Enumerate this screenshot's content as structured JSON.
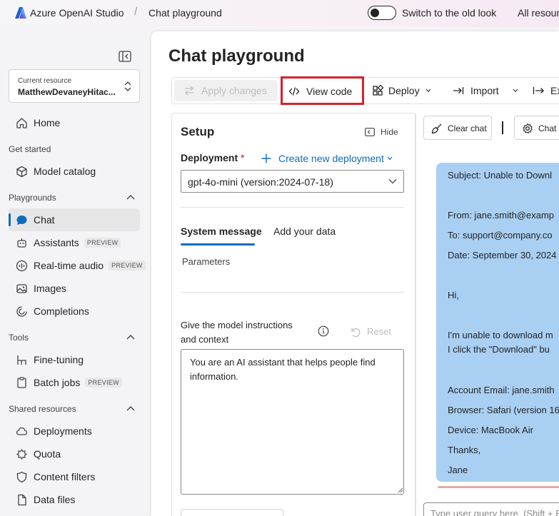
{
  "topbar": {
    "brand": "Azure OpenAI Studio",
    "separator": "/",
    "breadcrumb": "Chat playground",
    "toggle_label": "Switch to the old look",
    "all_resources": "All resour"
  },
  "sidebar": {
    "resource_label": "Current resource",
    "resource_value": "MatthewDevaneyHitac...",
    "home": "Home",
    "section_get_started": "Get started",
    "model_catalog": "Model catalog",
    "section_playgrounds": "Playgrounds",
    "chat": "Chat",
    "assistants": "Assistants",
    "realtime_audio": "Real-time audio",
    "images": "Images",
    "completions": "Completions",
    "section_tools": "Tools",
    "fine_tuning": "Fine-tuning",
    "batch_jobs": "Batch jobs",
    "section_shared": "Shared resources",
    "deployments": "Deployments",
    "quota": "Quota",
    "content_filters": "Content filters",
    "data_files": "Data files",
    "preview_badge": "PREVIEW"
  },
  "main": {
    "title": "Chat playground"
  },
  "toolbar": {
    "apply_changes": "Apply changes",
    "view_code": "View code",
    "deploy": "Deploy",
    "import": "Import",
    "export": "Ex"
  },
  "setup": {
    "title": "Setup",
    "hide": "Hide",
    "deployment_label": "Deployment",
    "required_mark": "*",
    "create_new_deployment": "Create new deployment",
    "deployment_value": "gpt-4o-mini (version:2024-07-18)",
    "tab_system_message": "System message",
    "tab_add_data": "Add your data",
    "parameters": "Parameters",
    "instructions_label": "Give the model instructions and context",
    "reset": "Reset",
    "system_message_text": "You are an AI assistant that helps people find information."
  },
  "chat": {
    "clear_chat": "Clear chat",
    "chat_settings": "Chat c",
    "query_placeholder": "Type user query here. (Shift + Enter for new line)",
    "message": {
      "subject": "Subject: Unable to Downl",
      "from": "From: jane.smith@examp",
      "to": "To: support@company.co",
      "date": "Date: September 30, 2024",
      "greeting": "Hi,",
      "body1": "I'm unable to download m",
      "body2": "I click the \"Download\" bu",
      "account": "Account Email: jane.smith",
      "browser": "Browser: Safari (version 16",
      "device": "Device: MacBook Air",
      "thanks": "Thanks,",
      "name": "Jane"
    }
  },
  "colors": {
    "accent": "#0f6cbd",
    "highlight_border": "#d9202a",
    "message_bubble": "#a9cff3"
  }
}
